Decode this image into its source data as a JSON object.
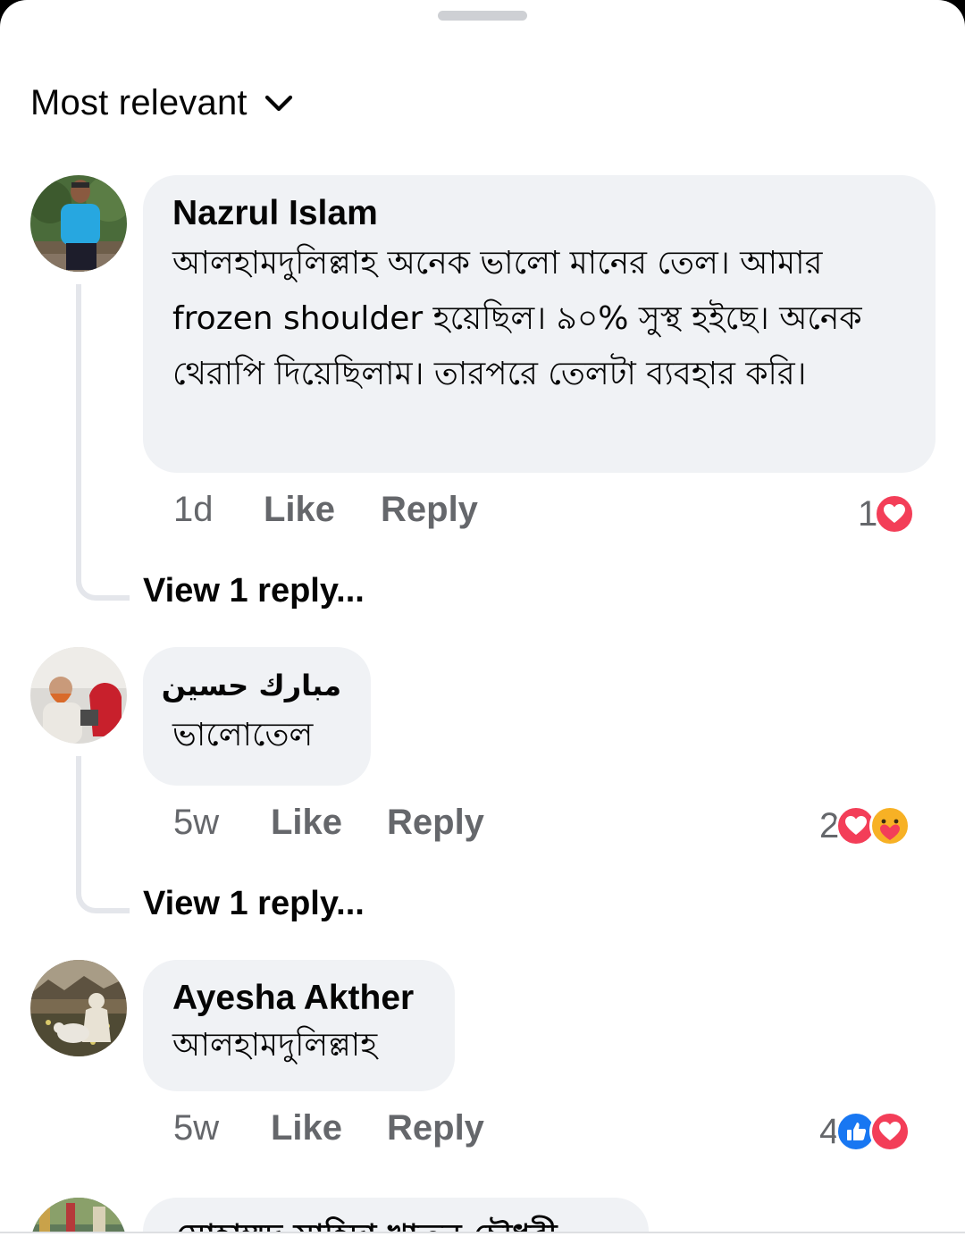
{
  "sort": {
    "label": "Most relevant"
  },
  "comments": [
    {
      "author": "Nazrul Islam",
      "text": "আলহামদুলিল্লাহ অনেক ভালো মানের তেল। আমার frozen shoulder হয়েছিল। ৯০% সুস্থ হইছে। অনেক থেরাপি দিয়েছিলাম। তারপরে তেলটা ব্যবহার করি।",
      "time": "1d",
      "like_label": "Like",
      "reply_label": "Reply",
      "reaction_count": "1",
      "reactions": [
        "love-icon"
      ],
      "view_replies": "View 1 reply..."
    },
    {
      "author": "مبارك حسين",
      "text": "ভালোতেল",
      "time": "5w",
      "like_label": "Like",
      "reply_label": "Reply",
      "reaction_count": "2",
      "reactions": [
        "love-icon",
        "care-icon"
      ],
      "view_replies": "View 1 reply..."
    },
    {
      "author": "Ayesha Akther",
      "text": "আলহামদুলিল্লাহ",
      "time": "5w",
      "like_label": "Like",
      "reply_label": "Reply",
      "reaction_count": "4",
      "reactions": [
        "like-icon",
        "love-icon"
      ]
    },
    {
      "author": "মোহাম্মদ সাহিদা খাতুন চৌধুরী"
    }
  ],
  "colors": {
    "bubble": "#f0f2f5",
    "secondary_text": "#65676b",
    "love": "#f33e58",
    "like": "#1877f2",
    "care": "#f7b125"
  }
}
